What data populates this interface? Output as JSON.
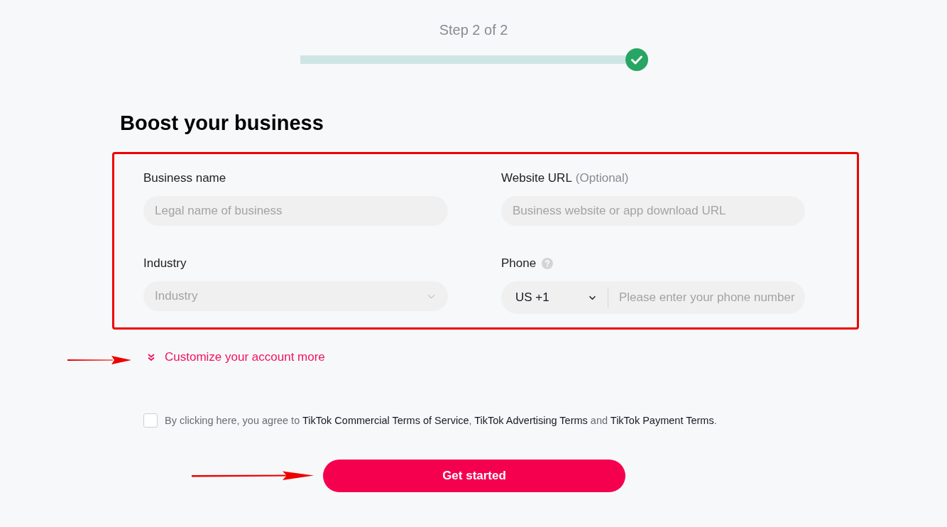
{
  "progress": {
    "step_label": "Step 2 of 2",
    "completed": true
  },
  "heading": "Boost your business",
  "form": {
    "highlighted": true,
    "fields": [
      {
        "kind": "text",
        "label": "Business name",
        "placeholder": "Legal name of business"
      },
      {
        "kind": "text",
        "label": "Website URL",
        "label_note": "(Optional)",
        "placeholder": "Business website or app download URL"
      },
      {
        "kind": "select",
        "label": "Industry",
        "placeholder": "Industry"
      },
      {
        "kind": "phone",
        "label": "Phone",
        "help": true,
        "country_code": "US +1",
        "placeholder": "Please enter your phone number"
      }
    ]
  },
  "customize_link": {
    "label": "Customize your account more",
    "expanded": false,
    "pointer_arrow": true
  },
  "terms": {
    "checked": false,
    "parts": [
      {
        "kind": "text",
        "text": "By clicking here, you agree to "
      },
      {
        "kind": "link",
        "text": "TikTok Commercial Terms of Service"
      },
      {
        "kind": "text",
        "text": ", "
      },
      {
        "kind": "link",
        "text": "TikTok Advertising Terms"
      },
      {
        "kind": "text",
        "text": " and "
      },
      {
        "kind": "link",
        "text": "TikTok Payment Terms"
      },
      {
        "kind": "text",
        "text": "."
      }
    ]
  },
  "submit": {
    "label": "Get started",
    "pointer_arrow": true
  }
}
